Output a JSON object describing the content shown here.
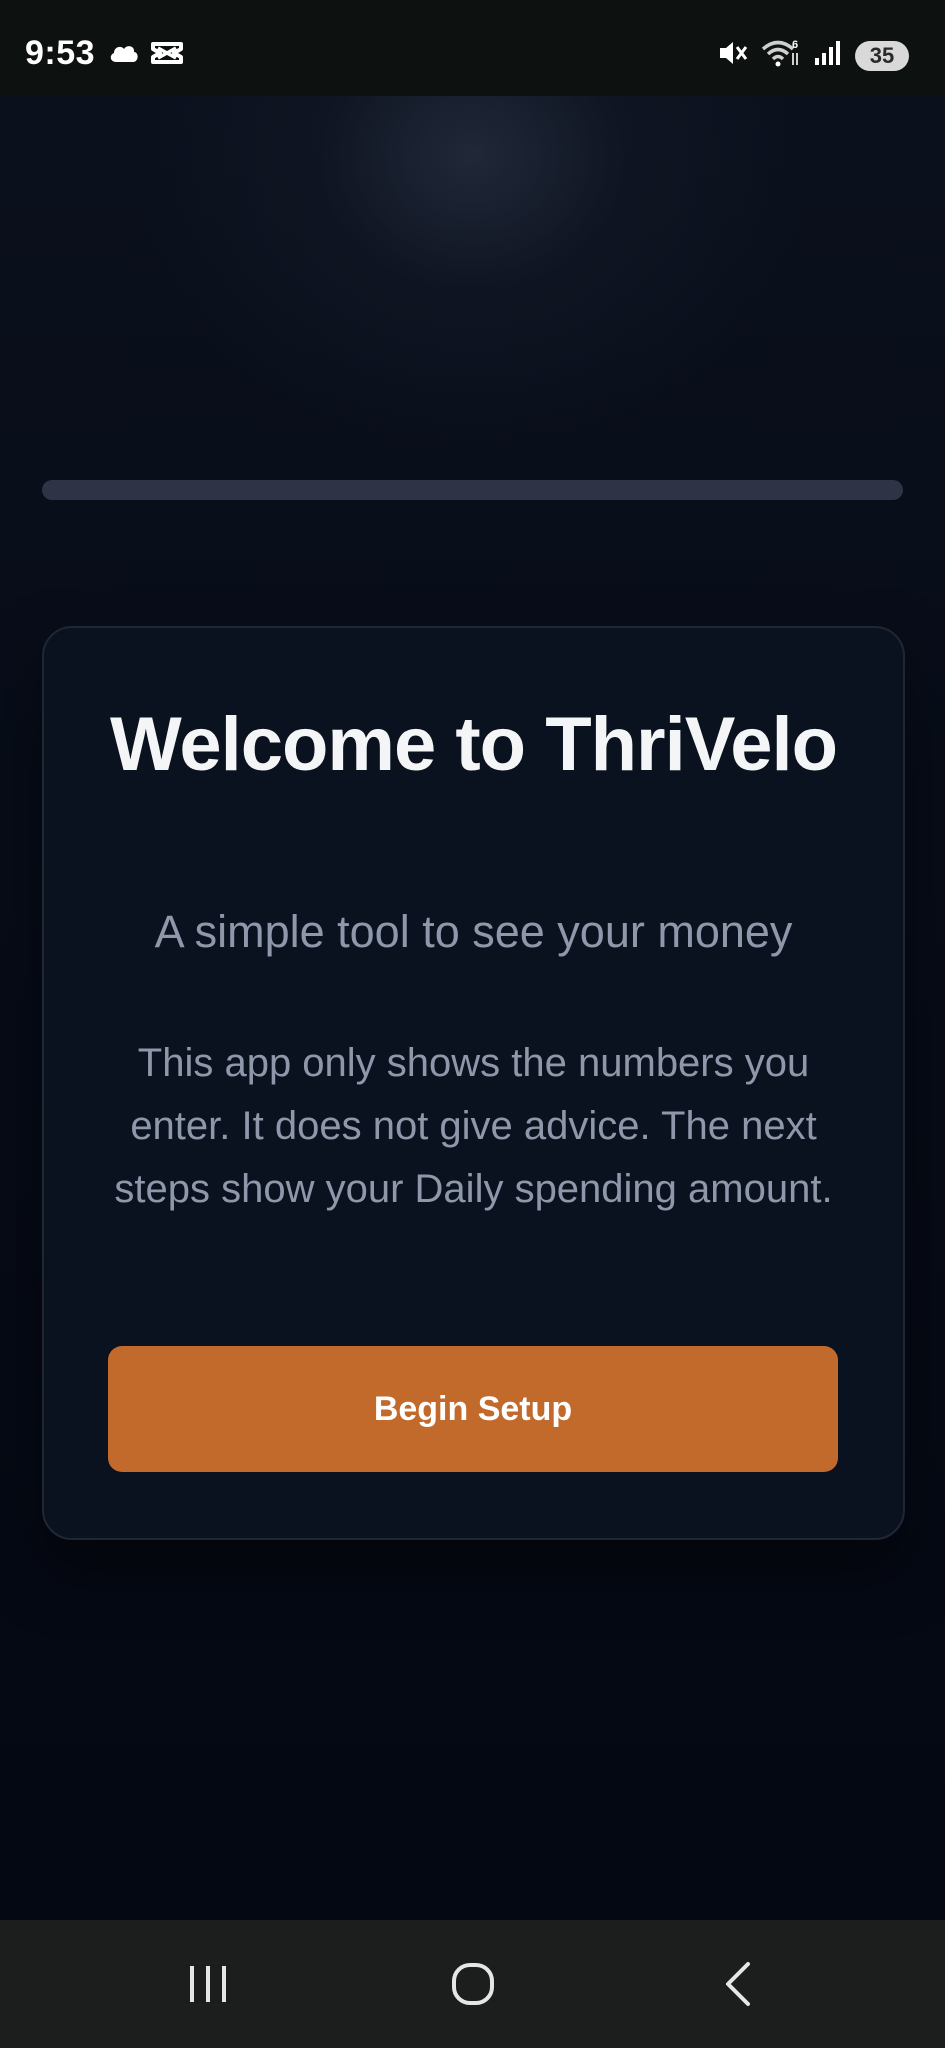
{
  "status_bar": {
    "time": "9:53",
    "battery_level": "35",
    "left_icons": [
      "cloud-icon",
      "capcut-icon"
    ],
    "right_icons": [
      "mute-icon",
      "wifi-icon",
      "signal-icon",
      "battery-icon"
    ]
  },
  "onboarding": {
    "progress_fraction": 0,
    "title": "Welcome to ThriVelo",
    "subtitle": "A simple tool to see your money",
    "description": "This app only shows the numbers you enter. It does not give advice. The next steps show your Daily spending amount.",
    "begin_button_label": "Begin Setup"
  },
  "nav_bar": {
    "buttons": [
      "recent-apps-icon",
      "home-icon",
      "back-icon"
    ]
  },
  "colors": {
    "accent": "#c2692c",
    "background": "#050913",
    "card": "#0b121f",
    "title_text": "#f4f5f7",
    "muted_text": "#8e98aa"
  }
}
